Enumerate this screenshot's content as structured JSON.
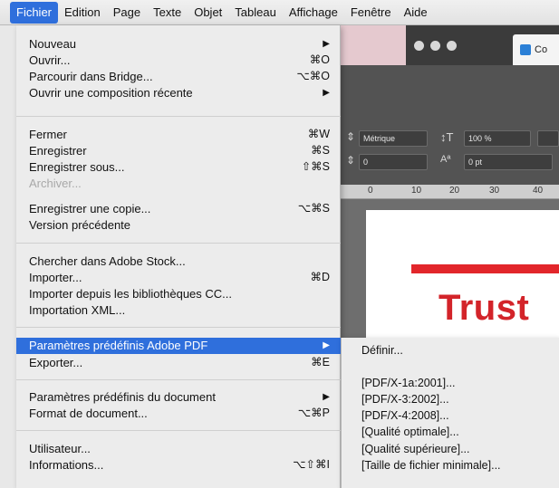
{
  "menubar": {
    "items": [
      "Fichier",
      "Edition",
      "Page",
      "Texte",
      "Objet",
      "Tableau",
      "Affichage",
      "Fenêtre",
      "Aide"
    ]
  },
  "fichier_menu": {
    "group1": [
      {
        "label": "Nouveau",
        "shortcut": "",
        "submenu": true
      },
      {
        "label": "Ouvrir...",
        "shortcut": "⌘O",
        "submenu": false
      },
      {
        "label": "Parcourir dans Bridge...",
        "shortcut": "⌥⌘O",
        "submenu": false
      },
      {
        "label": "Ouvrir une composition récente",
        "shortcut": "",
        "submenu": true
      }
    ],
    "group2": [
      {
        "label": "Fermer",
        "shortcut": "⌘W",
        "disabled": false
      },
      {
        "label": "Enregistrer",
        "shortcut": "⌘S",
        "disabled": false
      },
      {
        "label": "Enregistrer sous...",
        "shortcut": "⇧⌘S",
        "disabled": false
      },
      {
        "label": "Archiver...",
        "shortcut": "",
        "disabled": true
      },
      {
        "label": "Enregistrer une copie...",
        "shortcut": "⌥⌘S",
        "disabled": false
      },
      {
        "label": "Version précédente",
        "shortcut": "",
        "disabled": false
      }
    ],
    "group3": [
      {
        "label": "Chercher dans Adobe Stock...",
        "shortcut": ""
      },
      {
        "label": "Importer...",
        "shortcut": "⌘D"
      },
      {
        "label": "Importer depuis les bibliothèques CC...",
        "shortcut": ""
      },
      {
        "label": "Importation XML...",
        "shortcut": ""
      }
    ],
    "group4": [
      {
        "label": "Paramètres prédéfinis Adobe PDF",
        "shortcut": "",
        "submenu": true,
        "highlighted": true
      },
      {
        "label": "Exporter...",
        "shortcut": "⌘E",
        "submenu": false
      }
    ],
    "group5": [
      {
        "label": "Paramètres prédéfinis du document",
        "shortcut": "",
        "submenu": true
      },
      {
        "label": "Format de document...",
        "shortcut": "⌥⌘P",
        "submenu": false
      }
    ],
    "group6": [
      {
        "label": "Utilisateur...",
        "shortcut": ""
      },
      {
        "label": "Informations...",
        "shortcut": "⌥⇧⌘I"
      }
    ]
  },
  "pdf_submenu": {
    "items": [
      "Définir...",
      "[PDF/X-1a:2001]...",
      "[PDF/X-3:2002]...",
      "[PDF/X-4:2008]...",
      "[Qualité optimale]...",
      "[Qualité supérieure]...",
      "[Taille de fichier minimale]..."
    ]
  },
  "background_app": {
    "tab_label": "Co",
    "kerning_value": "Métrique",
    "scale_value": "100 %",
    "tracking_value": "0",
    "baseline_value": "0 pt",
    "ruler_ticks": [
      "0",
      "10",
      "20",
      "30",
      "40"
    ],
    "doc_text": "Trust"
  },
  "colors": {
    "highlight": "#2f6fdc",
    "doc_red": "#d3242a"
  }
}
